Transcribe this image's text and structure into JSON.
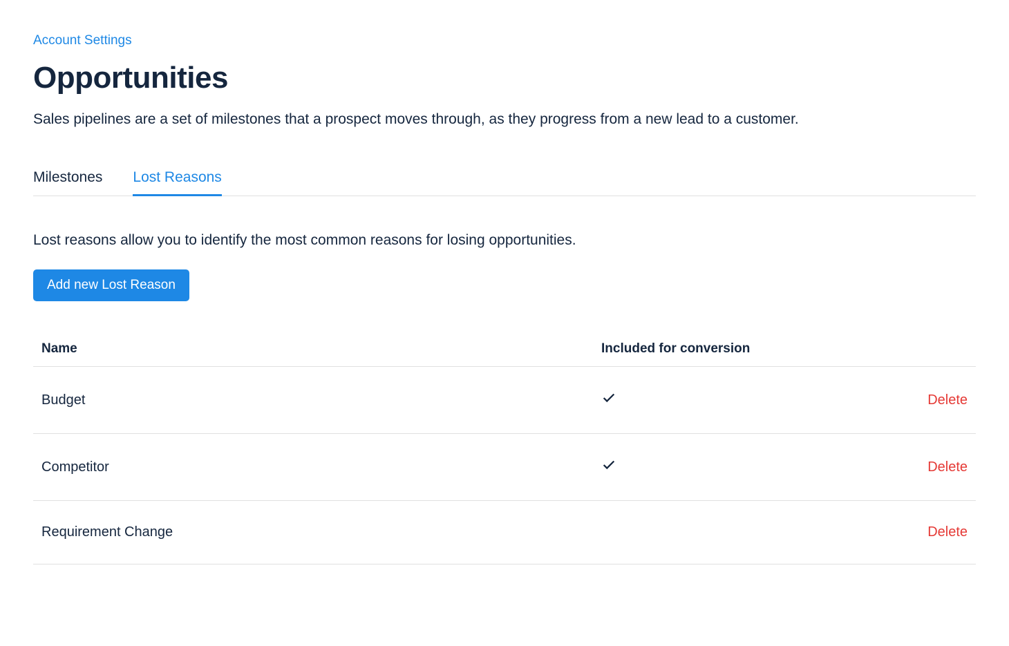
{
  "breadcrumb": "Account Settings",
  "page": {
    "title": "Opportunities",
    "description": "Sales pipelines are a set of milestones that a prospect moves through, as they progress from a new lead to a customer."
  },
  "tabs": [
    {
      "label": "Milestones",
      "active": false
    },
    {
      "label": "Lost Reasons",
      "active": true
    }
  ],
  "section": {
    "description": "Lost reasons allow you to identify the most common reasons for losing opportunities.",
    "add_button": "Add new Lost Reason"
  },
  "table": {
    "headers": {
      "name": "Name",
      "included": "Included for conversion"
    },
    "rows": [
      {
        "name": "Budget",
        "included": true,
        "action": "Delete"
      },
      {
        "name": "Competitor",
        "included": true,
        "action": "Delete"
      },
      {
        "name": "Requirement Change",
        "included": false,
        "action": "Delete"
      }
    ]
  }
}
